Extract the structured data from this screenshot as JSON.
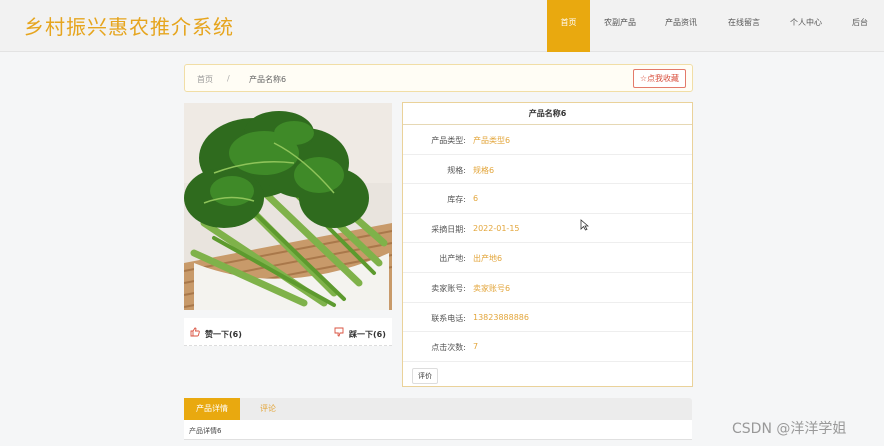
{
  "header": {
    "logo": "乡村振兴惠农推介系统",
    "nav": [
      {
        "label": "首页",
        "active": true
      },
      {
        "label": "农副产品",
        "active": false
      },
      {
        "label": "产品资讯",
        "active": false
      },
      {
        "label": "在线留言",
        "active": false
      },
      {
        "label": "个人中心",
        "active": false
      },
      {
        "label": "后台",
        "active": false
      }
    ]
  },
  "breadcrumb": {
    "home": "首页",
    "separator": "/",
    "current": "产品名称6",
    "favorite_label": "☆点我收藏"
  },
  "product": {
    "title": "产品名称6",
    "fields": [
      {
        "label": "产品类型:",
        "value": "产品类型6"
      },
      {
        "label": "规格:",
        "value": "规格6"
      },
      {
        "label": "库存:",
        "value": "6"
      },
      {
        "label": "采摘日期:",
        "value": "2022-01-15"
      },
      {
        "label": "出产地:",
        "value": "出产地6"
      },
      {
        "label": "卖家账号:",
        "value": "卖家账号6"
      },
      {
        "label": "联系电话:",
        "value": "13823888886"
      },
      {
        "label": "点击次数:",
        "value": "7"
      }
    ],
    "rate_button": "评价"
  },
  "votes": {
    "up_label": "赞一下(6)",
    "down_label": "踩一下(6)"
  },
  "tabs": [
    {
      "label": "产品详情",
      "active": true
    },
    {
      "label": "评论",
      "active": false
    }
  ],
  "detail_text": "产品详情6",
  "watermark": "CSDN @洋洋学姐",
  "colors": {
    "accent": "#e9a90f",
    "logo": "#e6a51e",
    "value": "#e3a63c"
  }
}
